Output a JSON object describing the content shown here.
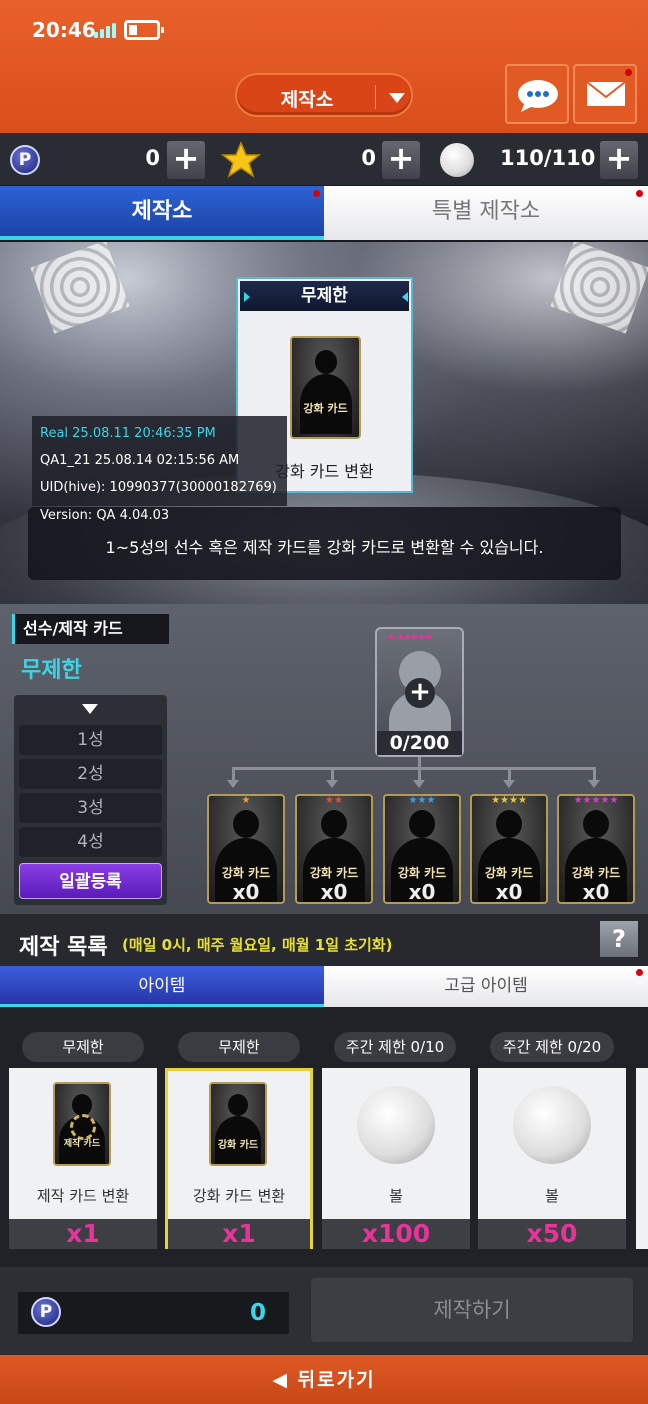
{
  "status_bar": {
    "time": "20:46"
  },
  "header": {
    "title": "제작소"
  },
  "currency": {
    "points": "0",
    "stars": "0",
    "balls": "110/110"
  },
  "tabs": [
    {
      "label": "제작소"
    },
    {
      "label": "특별 제작소"
    }
  ],
  "banner": {
    "card_header": "무제한",
    "card_label": "강화 카드",
    "card_title": "강화 카드 변환",
    "description": "1~5성의 선수 혹은 제작 카드를 강화 카드로 변환할 수 있습니다."
  },
  "debug": {
    "line1": "Real   25.08.11 20:46:35 PM",
    "line2": "QA1_21   25.08.14 02:15:56 AM",
    "line3": "UID(hive): 10990377(30000182769)",
    "line4": "Version: QA 4.04.03"
  },
  "middle": {
    "section_label": "선수/제작 카드",
    "limit_label": "무제한",
    "filters": [
      "1성",
      "2성",
      "3성",
      "4성"
    ],
    "bulk_button": "일괄등록",
    "slot_count": "0/200",
    "cards": [
      {
        "label": "강화 카드",
        "count": "x0"
      },
      {
        "label": "강화 카드",
        "count": "x0"
      },
      {
        "label": "강화 카드",
        "count": "x0"
      },
      {
        "label": "강화 카드",
        "count": "x0"
      },
      {
        "label": "강화 카드",
        "count": "x0"
      }
    ]
  },
  "craft_list": {
    "title": "제작 목록",
    "subtitle": "(매일 0시, 매주 월요일, 매월 1일 초기화)",
    "help": "?",
    "tabs": [
      {
        "label": "아이템"
      },
      {
        "label": "고급 아이템"
      }
    ],
    "items": [
      {
        "tag": "무제한",
        "card_label": "제작 카드",
        "name": "제작 카드 변환",
        "qty": "x1"
      },
      {
        "tag": "무제한",
        "card_label": "강화 카드",
        "name": "강화 카드 변환",
        "qty": "x1"
      },
      {
        "tag": "주간 제한 0/10",
        "name": "볼",
        "qty": "x100"
      },
      {
        "tag": "주간 제한 0/20",
        "name": "볼",
        "qty": "x50"
      }
    ]
  },
  "footer": {
    "points": "0",
    "craft_button": "제작하기",
    "back_label": "◀ 뒤로가기"
  },
  "colors": {
    "header_orange": "#e0571f",
    "tab_blue": "#1e4fb8",
    "accent_cyan": "#3ad6e8",
    "qty_pink": "#e8339a",
    "selected_gold": "#e8d23a"
  }
}
